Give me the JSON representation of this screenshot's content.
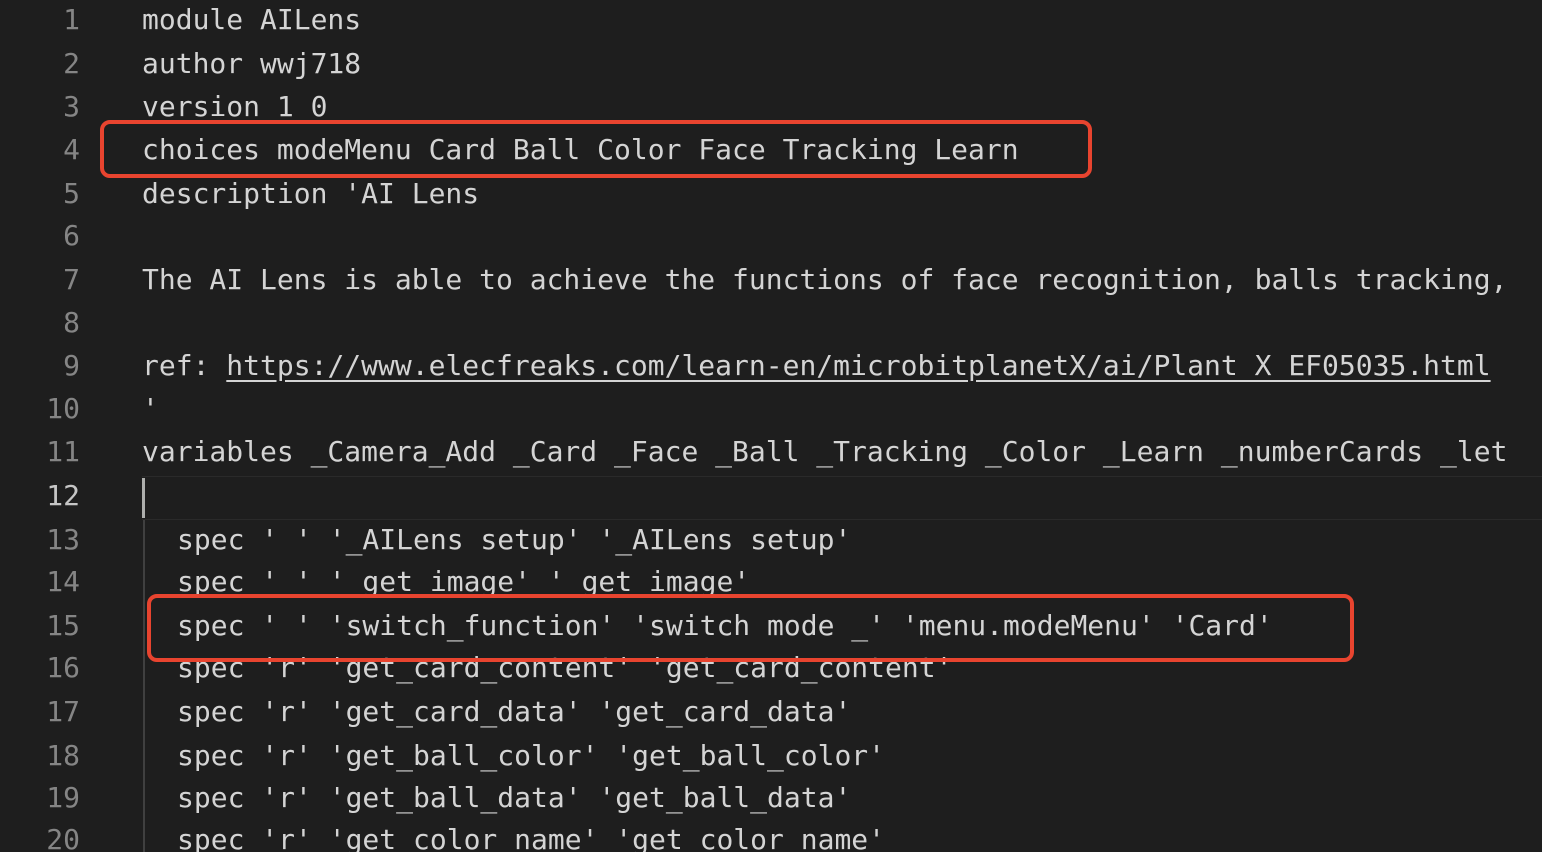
{
  "editor": {
    "lines": [
      {
        "num": "1",
        "text": "module AILens"
      },
      {
        "num": "2",
        "text": "author wwj718"
      },
      {
        "num": "3",
        "text": "version 1 0"
      },
      {
        "num": "4",
        "text": "choices modeMenu Card Ball Color Face Tracking Learn"
      },
      {
        "num": "5",
        "text": "description 'AI Lens"
      },
      {
        "num": "6",
        "text": ""
      },
      {
        "num": "7",
        "text": "The AI Lens is able to achieve the functions of face recognition, balls tracking,"
      },
      {
        "num": "8",
        "text": ""
      },
      {
        "num": "9",
        "prefix": "ref: ",
        "url": "https://www.elecfreaks.com/learn-en/microbitplanetX/ai/Plant_X_EF05035.html"
      },
      {
        "num": "10",
        "text": "'"
      },
      {
        "num": "11",
        "text": "variables _Camera_Add _Card _Face _Ball _Tracking _Color _Learn _numberCards _let"
      },
      {
        "num": "12",
        "text": ""
      },
      {
        "num": "13",
        "text": "spec ' ' '_AILens setup' '_AILens setup'"
      },
      {
        "num": "14",
        "text": "spec ' ' '_get image' '_get image'"
      },
      {
        "num": "15",
        "text": "spec ' ' 'switch_function' 'switch mode _' 'menu.modeMenu' 'Card'"
      },
      {
        "num": "16",
        "text": "spec 'r' 'get_card_content' 'get_card_content'"
      },
      {
        "num": "17",
        "text": "spec 'r' 'get_card_data' 'get_card_data'"
      },
      {
        "num": "18",
        "text": "spec 'r' 'get_ball_color' 'get_ball_color'"
      },
      {
        "num": "19",
        "text": "spec 'r' 'get_ball_data' 'get_ball_data'"
      },
      {
        "num": "20",
        "text": "spec 'r' 'get_color_name' 'get_color_name'"
      }
    ],
    "active_line": "12",
    "highlight_color": "#e8442f"
  }
}
